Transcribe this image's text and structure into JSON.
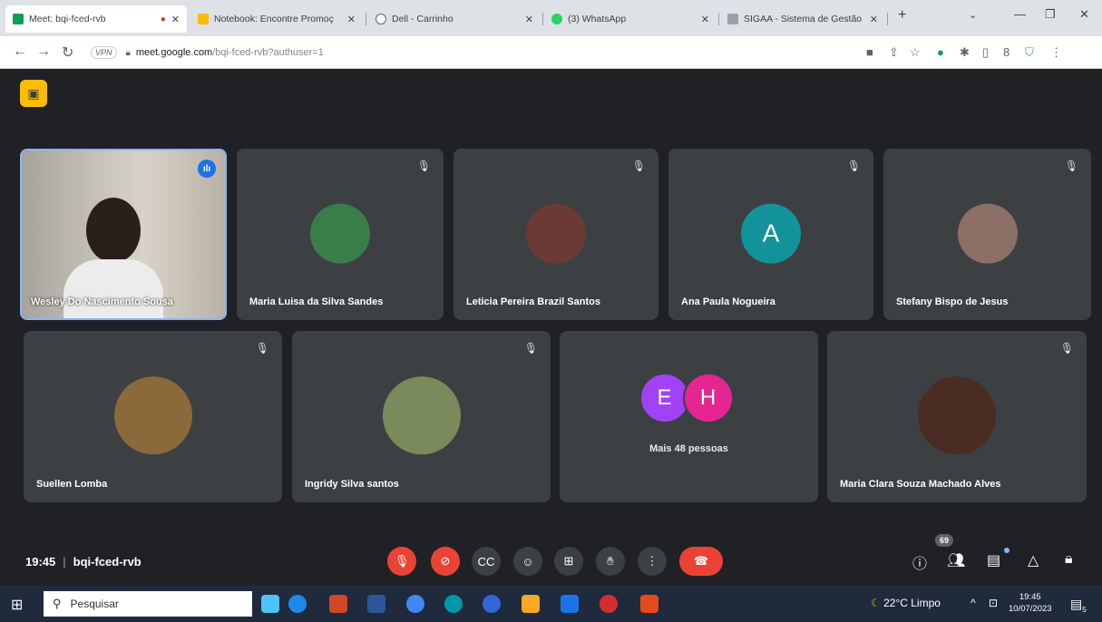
{
  "browser": {
    "tabs": [
      {
        "title": "Meet: bqi-fced-rvb",
        "favicon_color": "#0f9d58",
        "active": true
      },
      {
        "title": "Notebook: Encontre Promoç",
        "favicon_color": "#fbbc04",
        "active": false
      },
      {
        "title": "Dell - Carrinho",
        "favicon_color": "#5f6368",
        "active": false
      },
      {
        "title": "(3) WhatsApp",
        "favicon_color": "#25d366",
        "active": false
      },
      {
        "title": "SIGAA - Sistema de Gestão",
        "favicon_color": "#9aa0a6",
        "active": false
      }
    ],
    "new_tab_label": "+",
    "url_host": "meet.google.com",
    "url_path": "/bqi-fced-rvb?authuser=1",
    "vpn_label": "VPN"
  },
  "meeting": {
    "code": "bqi-fced-rvb",
    "time": "19:45",
    "participant_count": "69",
    "speaker": {
      "name": "Wesley Do Nascimento Sousa"
    },
    "tiles": [
      {
        "name": "Maria Luisa da Silva Sandes",
        "avatar_color": "#3b7d4a"
      },
      {
        "name": "Leticia Pereira Brazil Santos",
        "avatar_color": "#6b3a34"
      },
      {
        "name": "Ana Paula Nogueira",
        "avatar_letter": "A",
        "avatar_color": "#12939a"
      },
      {
        "name": "Stefany Bispo de Jesus",
        "avatar_color": "#8c6f66"
      },
      {
        "name": "Suellen Lomba",
        "avatar_color": "#8a6a3a"
      },
      {
        "name": "Ingridy Silva santos",
        "avatar_color": "#7a8a5a"
      },
      {
        "name": "Maria Clara Souza Machado Alves",
        "avatar_color": "#4a2c22"
      }
    ],
    "more": {
      "label": "Mais 48 pessoas",
      "letters": [
        "E",
        "H"
      ],
      "colors": [
        "#a142f4",
        "#e52592"
      ]
    }
  },
  "taskbar": {
    "search_placeholder": "Pesquisar",
    "weather": "22°C Limpo",
    "clock_time": "19:45",
    "clock_date": "10/07/2023",
    "notification_count": "5"
  }
}
